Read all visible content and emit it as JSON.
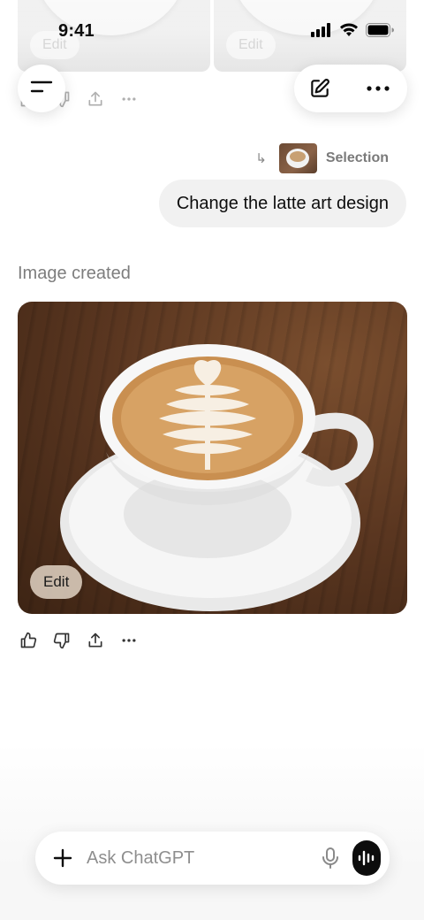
{
  "status_bar": {
    "time": "9:41"
  },
  "previous_images": [
    {
      "edit_label": "Edit"
    },
    {
      "edit_label": "Edit"
    }
  ],
  "conversation": {
    "selection_label": "Selection",
    "selection_arrow": "↳",
    "user_message": "Change the latte art design",
    "assistant_status": "Image created",
    "image_edit_label": "Edit"
  },
  "reactions": {
    "icons": [
      "thumbs-up-icon",
      "thumbs-down-icon",
      "share-icon",
      "more-icon"
    ]
  },
  "input": {
    "placeholder": "Ask ChatGPT",
    "value": ""
  },
  "colors": {
    "bubble": "#f1f1f1",
    "muted_text": "#7d7d7d",
    "voice_button": "#0d0d0d"
  }
}
